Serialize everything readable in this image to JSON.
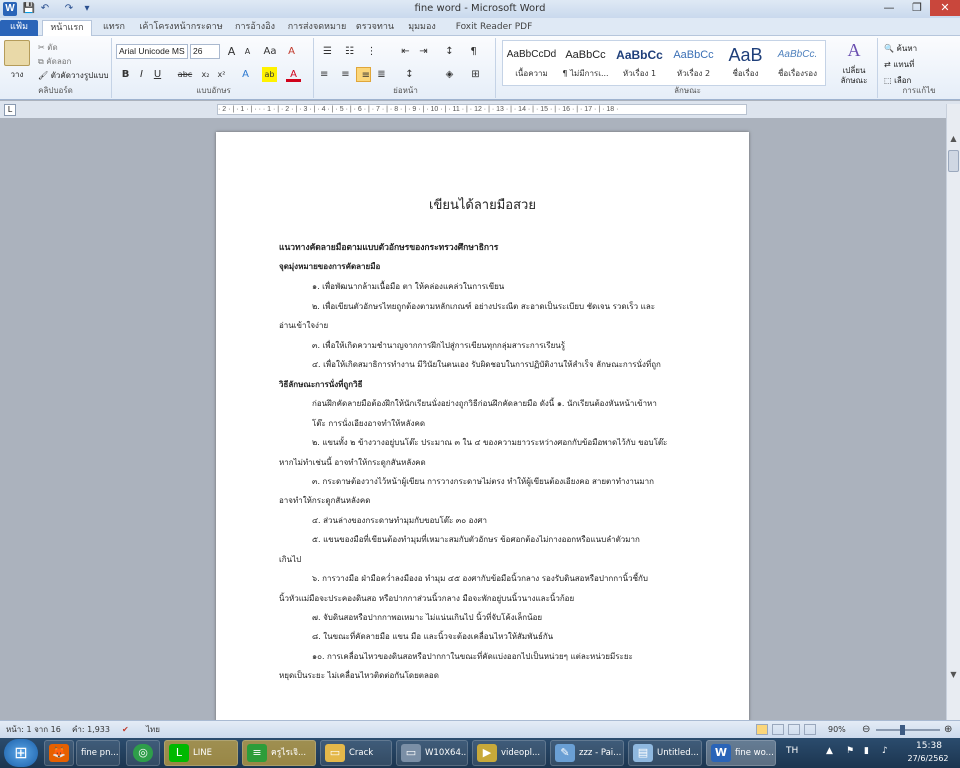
{
  "window": {
    "title": "fine word - Microsoft Word"
  },
  "quick_access": [
    {
      "icon": "word-logo-icon",
      "glyph": "W"
    },
    {
      "icon": "save-icon",
      "glyph": "💾"
    },
    {
      "icon": "undo-icon",
      "glyph": "↶"
    },
    {
      "icon": "redo-icon",
      "glyph": "↷"
    },
    {
      "icon": "customize-icon",
      "glyph": "▾"
    }
  ],
  "window_controls": {
    "minimize": "—",
    "restore": "❐",
    "close": "✕"
  },
  "tabs": [
    "แฟ้ม",
    "หน้าแรก",
    "แทรก",
    "เค้าโครงหน้ากระดาษ",
    "การอ้างอิง",
    "การส่งจดหมาย",
    "ตรวจทาน",
    "มุมมอง",
    "Foxit Reader PDF"
  ],
  "ribbon": {
    "clipboard": {
      "paste": "วาง",
      "cut": "ตัด",
      "copy": "คัดลอก",
      "format_painter": "ตัวคัดวางรูปแบบ",
      "label": "คลิปบอร์ด"
    },
    "font": {
      "name": "Arial Unicode MS",
      "size": "26",
      "grow": "A",
      "shrink": "A",
      "case": "Aa",
      "clear": "A",
      "bold": "B",
      "italic": "I",
      "underline": "U",
      "strike": "abc",
      "sub": "x₂",
      "sup": "x²",
      "effects": "A",
      "highlight": "ab",
      "color": "A",
      "label": "แบบอักษร"
    },
    "paragraph": {
      "bullets": "☰",
      "numbering": "☷",
      "multilevel": "⋮",
      "decrease": "⇤",
      "increase": "⇥",
      "sort": "↕",
      "show": "¶",
      "left": "≡",
      "center": "≡",
      "right": "≡",
      "justify": "≣",
      "spacing": "↕",
      "shading": "◈",
      "borders": "⊞",
      "label": "ย่อหน้า"
    },
    "styles": {
      "items": [
        {
          "sample": "AaBbCcDd",
          "name": "เนื้อความ"
        },
        {
          "sample": "AaBbCc",
          "name": "¶ ไม่มีการเ..."
        },
        {
          "sample": "AaBbCc",
          "name": "หัวเรื่อง 1"
        },
        {
          "sample": "AaBbCc",
          "name": "หัวเรื่อง 2"
        },
        {
          "sample": "AaB",
          "name": "ชื่อเรื่อง"
        },
        {
          "sample": "AaBbCc.",
          "name": "ชื่อเรื่องรอง"
        }
      ],
      "change": "เปลี่ยนลักษณะ",
      "label": "ลักษณะ"
    },
    "editing": {
      "find": "ค้นหา",
      "replace": "แทนที่",
      "select": "เลือก",
      "label": "การแก้ไข"
    }
  },
  "ruler": "· 2 · | · 1 · | · · · 1 · | · 2 · | · 3 · | · 4 · | · 5 · | · 6 · | · 7 · | · 8 · | · 9 · | · 10 · | · 11 · | · 12 · | · 13 · | · 14 · | · 15 · | · 16 · | · 17 · | · 18 ·",
  "document": {
    "title": "เขียนได้ลายมือสวย",
    "heading1": "แนวทางคัดลายมือตามแบบตัวอักษรของกระทรวงศึกษาธิการ",
    "heading2": "จุดมุ่งหมายของการคัดลายมือ",
    "lines": [
      "๑. เพื่อพัฒนากล้ามเนื้อมือ ตา ให้คล่องแคล่วในการเขียน",
      "๒. เพื่อเขียนตัวอักษรไทยถูกต้องตามหลักเกณฑ์ อย่างประณีต สะอาดเป็นระเบียบ ชัดเจน รวดเร็ว และ",
      "อ่านเข้าใจง่าย",
      "๓. เพื่อให้เกิดความชำนาญจากการฝึกไปสู่การเขียนทุกกลุ่มสาระการเรียนรู้",
      "๔. เพื่อให้เกิดสมาธิการทำงาน มีวินัยในตนเอง รับผิดชอบในการปฏิบัติงานให้สำเร็จ ลักษณะการนั่งที่ถูก",
      "วิธีลักษณะการนั่งที่ถูกวิธี",
      "ก่อนฝึกคัดลายมือต้องฝึกให้นักเรียนนั่งอย่างถูกวิธีก่อนฝึกคัดลายมือ ดังนี้ ๑. นักเรียนต้องหันหน้าเข้าหา",
      "โต๊ะ การนั่งเอียงอาจทำให้หลังคด",
      "๒. แขนทั้ง ๒ ข้างวางอยู่บนโต๊ะ ประมาณ ๓ ใน ๔ ของความยาวระหว่างศอกกับข้อมือพาดไว้กับ ขอบโต๊ะ",
      "หากไม่ทำเช่นนี้ อาจทำให้กระดูกสันหลังคด",
      "๓. กระดาษต้องวางไว้หน้าผู้เขียน การวางกระดาษไม่ตรง ทำให้ผู้เขียนต้องเอียงคอ สายตาทำงานมาก",
      "อาจทำให้กระดูกสันหลังคด",
      "๔. ส่วนล่างของกระดาษทำมุมกับขอบโต๊ะ ๓๐ องศา",
      "๕. แขนของมือที่เขียนต้องทำมุมที่เหมาะสมกับตัวอักษร ข้อศอกต้องไม่กางออกหรือแนบลำตัวมาก",
      "เกินไป",
      "๖. การวางมือ ฝ่ามือคว่ำลงมืองอ ทำมุม ๔๕ องศากับข้อมือนิ้วกลาง รองรับดินสอหรือปากกานิ้วชี้กับ",
      "นิ้วหัวแม่มือจะประคองดินสอ หรือปากกาส่วนนิ้วกลาง มือจะพักอยู่บนนิ้วนางและนิ้วก้อย",
      "๗. จับดินสอหรือปากกาพอเหมาะ ไม่แน่นเกินไป นิ้วที่จับโค้งเล็กน้อย",
      "๘. ในขณะที่คัดลายมือ แขน มือ และนิ้วจะต้องเคลื่อนไหวให้สัมพันธ์กัน",
      "๑๐. การเคลื่อนไหวของดินสอหรือปากกาในขณะที่คัดแบ่งออกไปเป็นหน่วยๆ แต่ละหน่วยมีระยะ",
      "หยุดเป็นระยะ ไม่เคลื่อนไหวติดต่อกันโดยตลอด"
    ]
  },
  "statusbar": {
    "page": "หน้า: 1 จาก 16",
    "words": "คำ: 1,933",
    "language": "ไทย",
    "zoom": "90%"
  },
  "taskbar": {
    "start": "⊞",
    "tasks": [
      {
        "icon": "firefox-icon",
        "glyph": "🦊",
        "label": "",
        "color": "#e66000"
      },
      {
        "icon": "firefox-icon",
        "glyph": "🦊",
        "label": "fine pn...",
        "color": "#e66000"
      },
      {
        "icon": "chrome-icon",
        "glyph": "◎",
        "label": "",
        "color": "#2e9e4a"
      },
      {
        "icon": "line-icon",
        "glyph": "L",
        "label": "LINE",
        "color": "#00b900"
      },
      {
        "icon": "notes-icon",
        "glyph": "≡",
        "label": "ครูไรเจิ...",
        "color": "#2d9d3a"
      },
      {
        "icon": "folder-icon",
        "glyph": "▭",
        "label": "Crack",
        "color": "#e4b84a"
      },
      {
        "icon": "drive-icon",
        "glyph": "▭",
        "label": "W10X64...",
        "color": "#7b8fa6"
      },
      {
        "icon": "video-icon",
        "glyph": "▶",
        "label": "videopl...",
        "color": "#c8a93a"
      },
      {
        "icon": "paint-icon",
        "glyph": "✎",
        "label": "zzz - Pai...",
        "color": "#6a9fd4"
      },
      {
        "icon": "notepad-icon",
        "glyph": "▤",
        "label": "Untitled...",
        "color": "#8fb8df"
      },
      {
        "icon": "word-icon",
        "glyph": "W",
        "label": "fine wo...",
        "color": "#2a64b8"
      }
    ],
    "lang": "TH",
    "time": "15:38",
    "date": "27/6/2562"
  }
}
